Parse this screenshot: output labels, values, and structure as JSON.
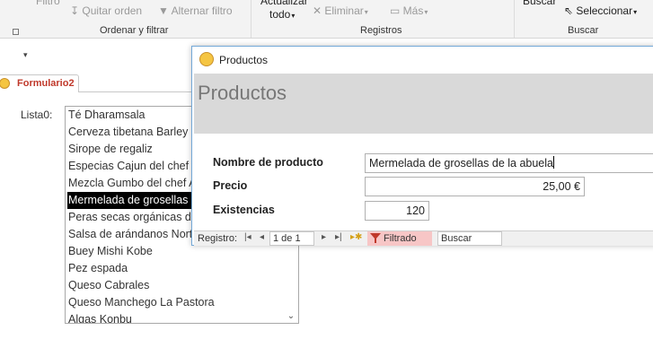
{
  "ribbon": {
    "filtro_label": "Filtro",
    "quitar_orden": "Quitar orden",
    "alternar_filtro": "Alternar filtro",
    "actualizar_line1": "Actualizar",
    "actualizar_line2": "todo",
    "eliminar": "Eliminar",
    "mas": "Más",
    "buscar": "Buscar",
    "seleccionar": "Seleccionar",
    "groups": {
      "ordenar": "Ordenar y filtrar",
      "registros": "Registros",
      "buscar": "Buscar"
    }
  },
  "document_tab": {
    "label": "Formulario2"
  },
  "lista": {
    "label": "Lista0:",
    "items": [
      "Té Dharamsala",
      "Cerveza tibetana Barley",
      "Sirope de regaliz",
      "Especias Cajun del chef Anton",
      "Mezcla Gumbo del chef Anton",
      "Mermelada de grosellas de la abuela",
      "Peras secas orgánicas del tío Bob",
      "Salsa de arándanos Northwoods",
      "Buey Mishi Kobe",
      "Pez espada",
      "Queso Cabrales",
      "Queso Manchego La Pastora",
      "Algas Konbu"
    ],
    "selected_index": 5
  },
  "popup": {
    "window_title": "Productos",
    "form_title": "Productos",
    "fields": {
      "nombre_label": "Nombre de producto",
      "nombre_value": "Mermelada de grosellas de la abuela",
      "precio_label": "Precio",
      "precio_value": "25,00 €",
      "existencias_label": "Existencias",
      "existencias_value": "120"
    },
    "navbar": {
      "registro_label": "Registro:",
      "record_position": "1 de 1",
      "filter_label": "Filtrado",
      "search_label": "Buscar"
    }
  }
}
